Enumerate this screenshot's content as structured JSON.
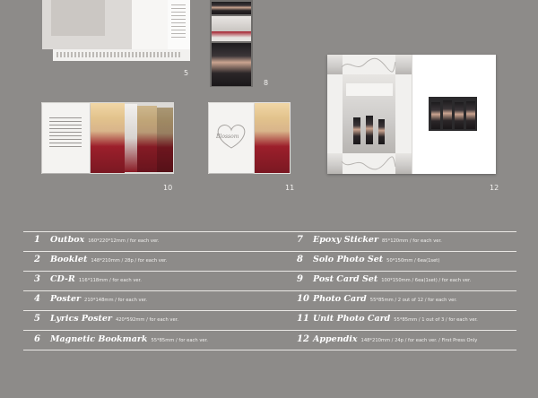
{
  "figures": [
    {
      "id": "fig-5",
      "label": "5"
    },
    {
      "id": "fig-8",
      "label": "8"
    },
    {
      "id": "fig-10",
      "label": "10"
    },
    {
      "id": "fig-11",
      "label": "11"
    },
    {
      "id": "fig-12",
      "label": "12"
    }
  ],
  "items": [
    {
      "num": "1",
      "name": "Outbox",
      "desc": "160*220*12mm / for each ver."
    },
    {
      "num": "2",
      "name": "Booklet",
      "desc": "148*210mm / 28p / for each ver."
    },
    {
      "num": "3",
      "name": "CD-R",
      "desc": "116*118mm / for each ver."
    },
    {
      "num": "4",
      "name": "Poster",
      "desc": "210*148mm / for each ver."
    },
    {
      "num": "5",
      "name": "Lyrics Poster",
      "desc": "420*592mm / for each ver."
    },
    {
      "num": "6",
      "name": "Magnetic Bookmark",
      "desc": "55*85mm / for each ver."
    },
    {
      "num": "7",
      "name": "Epoxy Sticker",
      "desc": "85*120mm / for each ver."
    },
    {
      "num": "8",
      "name": "Solo Photo Set",
      "desc": "50*150mm / 6ea(1set)"
    },
    {
      "num": "9",
      "name": "Post Card Set",
      "desc": "100*150mm / 6ea(1set) / for each ver."
    },
    {
      "num": "10",
      "name": "Photo Card",
      "desc": "55*85mm / 2 out of 12 / for each ver."
    },
    {
      "num": "11",
      "name": "Unit Photo Card",
      "desc": "55*85mm / 1 out of 3 / for each ver."
    },
    {
      "num": "12",
      "name": "Appendix",
      "desc": "148*210mm / 24p / for each ver. / First Press Only"
    }
  ],
  "art": {
    "card11_text": "Blossom"
  }
}
